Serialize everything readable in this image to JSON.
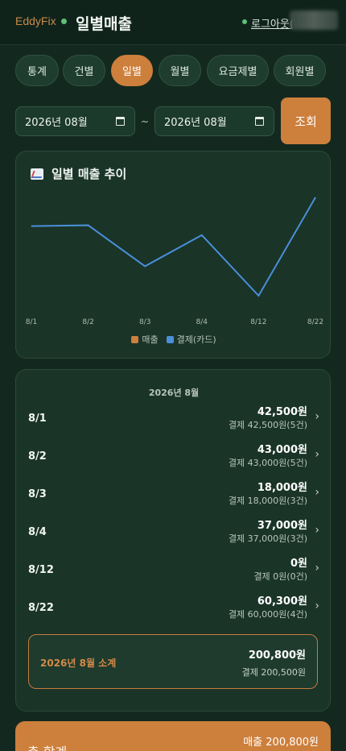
{
  "header": {
    "brand": "EddyFix",
    "title": "일별매출",
    "logout": "로그아웃("
  },
  "tabs": [
    {
      "label": "통계",
      "active": false
    },
    {
      "label": "건별",
      "active": false
    },
    {
      "label": "일별",
      "active": true
    },
    {
      "label": "월별",
      "active": false
    },
    {
      "label": "요금제별",
      "active": false
    },
    {
      "label": "회원별",
      "active": false
    }
  ],
  "filter": {
    "start": "2026년 08월",
    "separator": "~",
    "end": "2026년 08월",
    "search_label": "조회"
  },
  "chart": {
    "title": "일별 매출 추이",
    "icon": "chart-icon"
  },
  "chart_data": {
    "type": "line",
    "title": "일별 매출 추이",
    "categories": [
      "8/1",
      "8/2",
      "8/3",
      "8/4",
      "8/12",
      "8/22"
    ],
    "series": [
      {
        "name": "매출",
        "color": "#cd7f3c",
        "values": [
          42500,
          43000,
          18000,
          37000,
          0,
          60300
        ]
      },
      {
        "name": "결제(카드)",
        "color": "#4a8fd8",
        "values": [
          42500,
          43000,
          18000,
          37000,
          0,
          60000
        ]
      }
    ],
    "legend": "bottom-center",
    "grid": false
  },
  "list": {
    "heading": "2026년 8월",
    "rows": [
      {
        "date": "8/1",
        "amount": "42,500원",
        "payment": "결제 42,500원(5건)"
      },
      {
        "date": "8/2",
        "amount": "43,000원",
        "payment": "결제 43,000원(5건)"
      },
      {
        "date": "8/3",
        "amount": "18,000원",
        "payment": "결제 18,000원(3건)"
      },
      {
        "date": "8/4",
        "amount": "37,000원",
        "payment": "결제 37,000원(3건)"
      },
      {
        "date": "8/12",
        "amount": "0원",
        "payment": "결제 0원(0건)"
      },
      {
        "date": "8/22",
        "amount": "60,300원",
        "payment": "결제 60,000원(4건)"
      }
    ],
    "subtotal": {
      "label": "2026년 8월 소계",
      "amount": "200,800원",
      "payment": "결제 200,500원"
    }
  },
  "total": {
    "label": "총 합계",
    "sales": "매출 200,800원"
  },
  "colors": {
    "accent": "#cd7f3c",
    "background": "#13291f",
    "card": "#1a3428",
    "line": "#4a8fd8",
    "status": "#5fc07a"
  }
}
